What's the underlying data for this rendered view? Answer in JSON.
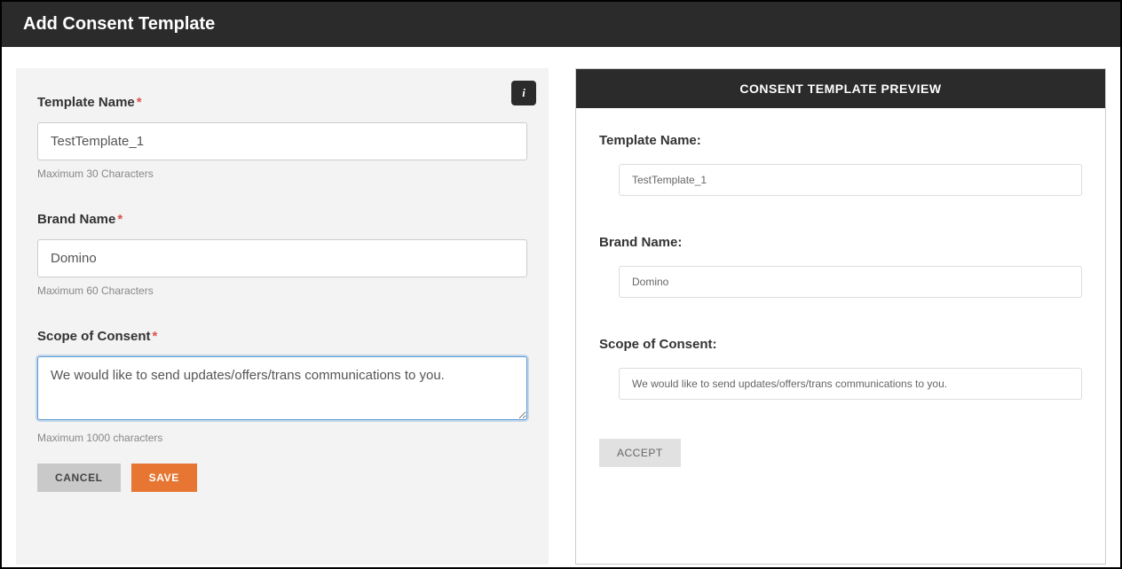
{
  "header": {
    "title": "Add Consent Template"
  },
  "form": {
    "template_name": {
      "label": "Template Name",
      "value": "TestTemplate_1",
      "helper": "Maximum 30 Characters"
    },
    "brand_name": {
      "label": "Brand Name",
      "value": "Domino",
      "helper": "Maximum 60 Characters"
    },
    "scope": {
      "label": "Scope of Consent",
      "value": "We would like to send updates/offers/trans communications to you.",
      "helper": "Maximum 1000 characters"
    },
    "buttons": {
      "cancel": "CANCEL",
      "save": "SAVE"
    }
  },
  "preview": {
    "title": "CONSENT TEMPLATE PREVIEW",
    "template_name": {
      "label": "Template Name:",
      "value": "TestTemplate_1"
    },
    "brand_name": {
      "label": "Brand Name:",
      "value": "Domino"
    },
    "scope": {
      "label": "Scope of Consent:",
      "value": "We would like to send updates/offers/trans communications to you."
    },
    "accept": "ACCEPT"
  }
}
